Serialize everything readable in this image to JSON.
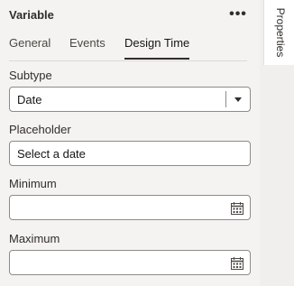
{
  "panel": {
    "title": "Variable",
    "more_label": "•••"
  },
  "tabs": [
    {
      "label": "General",
      "active": false
    },
    {
      "label": "Events",
      "active": false
    },
    {
      "label": "Design Time",
      "active": true
    }
  ],
  "fields": {
    "subtype": {
      "label": "Subtype",
      "value": "Date"
    },
    "placeholder": {
      "label": "Placeholder",
      "value": "Select a date"
    },
    "minimum": {
      "label": "Minimum",
      "value": ""
    },
    "maximum": {
      "label": "Maximum",
      "value": ""
    }
  },
  "side_rail": {
    "properties_label": "Properties"
  },
  "icons": {
    "more": "more-icon",
    "dropdown": "chevron-down-icon",
    "calendar": "calendar-icon"
  },
  "colors": {
    "panel_bg": "#f4f3f1",
    "text": "#312d2a",
    "border": "#8f8b86"
  }
}
